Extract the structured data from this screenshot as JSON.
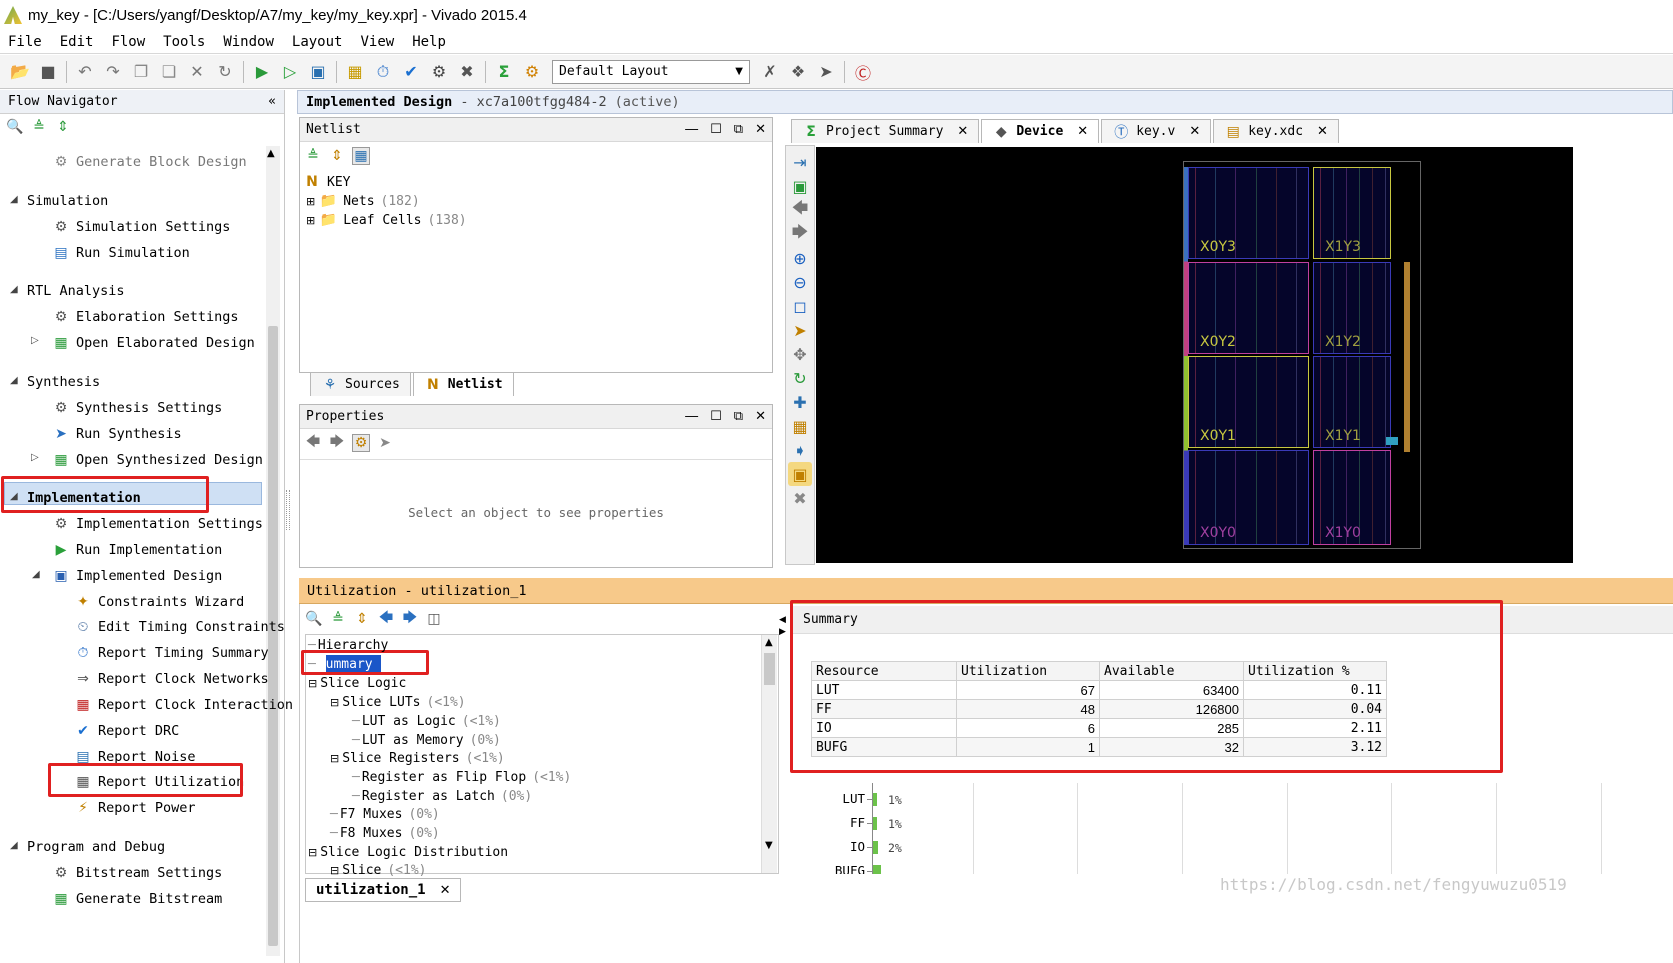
{
  "window": {
    "title": "my_key - [C:/Users/yangf/Desktop/A7/my_key/my_key.xpr] - Vivado 2015.4"
  },
  "menu": [
    "File",
    "Edit",
    "Flow",
    "Tools",
    "Window",
    "Layout",
    "View",
    "Help"
  ],
  "toolbar": {
    "layout_select": "Default Layout"
  },
  "flow_navigator": {
    "title": "Flow Navigator",
    "items": {
      "generate_block": "Generate Block Design",
      "simulation": "Simulation",
      "sim_settings": "Simulation Settings",
      "run_sim": "Run Simulation",
      "rtl": "RTL Analysis",
      "elab_settings": "Elaboration Settings",
      "open_elab": "Open Elaborated Design",
      "synthesis": "Synthesis",
      "synth_settings": "Synthesis Settings",
      "run_synth": "Run Synthesis",
      "open_synth": "Open Synthesized Design",
      "implementation": "Implementation",
      "impl_settings": "Implementation Settings",
      "run_impl": "Run Implementation",
      "impl_design": "Implemented Design",
      "constraints_wizard": "Constraints Wizard",
      "edit_timing": "Edit Timing Constraints",
      "report_timing": "Report Timing Summary",
      "report_clock_networks": "Report Clock Networks",
      "report_clock_interaction": "Report Clock Interaction",
      "report_drc": "Report DRC",
      "report_noise": "Report Noise",
      "report_utilization": "Report Utilization",
      "report_power": "Report Power",
      "program_debug": "Program and Debug",
      "bitstream_settings": "Bitstream Settings",
      "generate_bitstream": "Generate Bitstream"
    }
  },
  "design_header": {
    "title": "Implemented Design",
    "part": "- xc7a100tfgg484-2",
    "state": "(active)"
  },
  "netlist": {
    "title": "Netlist",
    "root": "KEY",
    "nets": "Nets",
    "nets_count": "(182)",
    "leaf": "Leaf Cells",
    "leaf_count": "(138)",
    "tabs": [
      "Sources",
      "Netlist"
    ]
  },
  "properties": {
    "title": "Properties",
    "empty_text": "Select an object to see properties"
  },
  "device_tabs": [
    "Project Summary",
    "Device",
    "key.v",
    "key.xdc"
  ],
  "clock_regions": [
    "X0Y3",
    "X1Y3",
    "X0Y2",
    "X1Y2",
    "X0Y1",
    "X1Y1",
    "X0Y0",
    "X1Y0"
  ],
  "utilization": {
    "header": "Utilization - utilization_1",
    "tree": [
      {
        "label": "Hierarchy",
        "pct": ""
      },
      {
        "label": "Summary",
        "pct": ""
      },
      {
        "label": "Slice Logic",
        "pct": ""
      },
      {
        "label": "Slice LUTs",
        "pct": "(<1%)"
      },
      {
        "label": "LUT as Logic",
        "pct": "(<1%)"
      },
      {
        "label": "LUT as Memory",
        "pct": "(0%)"
      },
      {
        "label": "Slice Registers",
        "pct": "(<1%)"
      },
      {
        "label": "Register as Flip Flop",
        "pct": "(<1%)"
      },
      {
        "label": "Register as Latch",
        "pct": "(0%)"
      },
      {
        "label": "F7 Muxes",
        "pct": "(0%)"
      },
      {
        "label": "F8 Muxes",
        "pct": "(0%)"
      },
      {
        "label": "Slice Logic Distribution",
        "pct": ""
      },
      {
        "label": "Slice",
        "pct": "(<1%)"
      }
    ],
    "summary_title": "Summary",
    "table_headers": [
      "Resource",
      "Utilization",
      "Available",
      "Utilization %"
    ],
    "rows": [
      [
        "LUT",
        "67",
        "63400",
        "0.11"
      ],
      [
        "FF",
        "48",
        "126800",
        "0.04"
      ],
      [
        "IO",
        "6",
        "285",
        "2.11"
      ],
      [
        "BUFG",
        "1",
        "32",
        "3.12"
      ]
    ],
    "graph": [
      {
        "label": "LUT",
        "pct_label": "1%",
        "pct": 0.11
      },
      {
        "label": "FF",
        "pct_label": "1%",
        "pct": 0.04
      },
      {
        "label": "IO",
        "pct_label": "2%",
        "pct": 2.11
      },
      {
        "label": "BUFG",
        "pct_label": "",
        "pct": 3.12
      }
    ],
    "bottom_tab": "utilization_1"
  },
  "watermark": "https://blog.csdn.net/fengyuwuzu0519"
}
